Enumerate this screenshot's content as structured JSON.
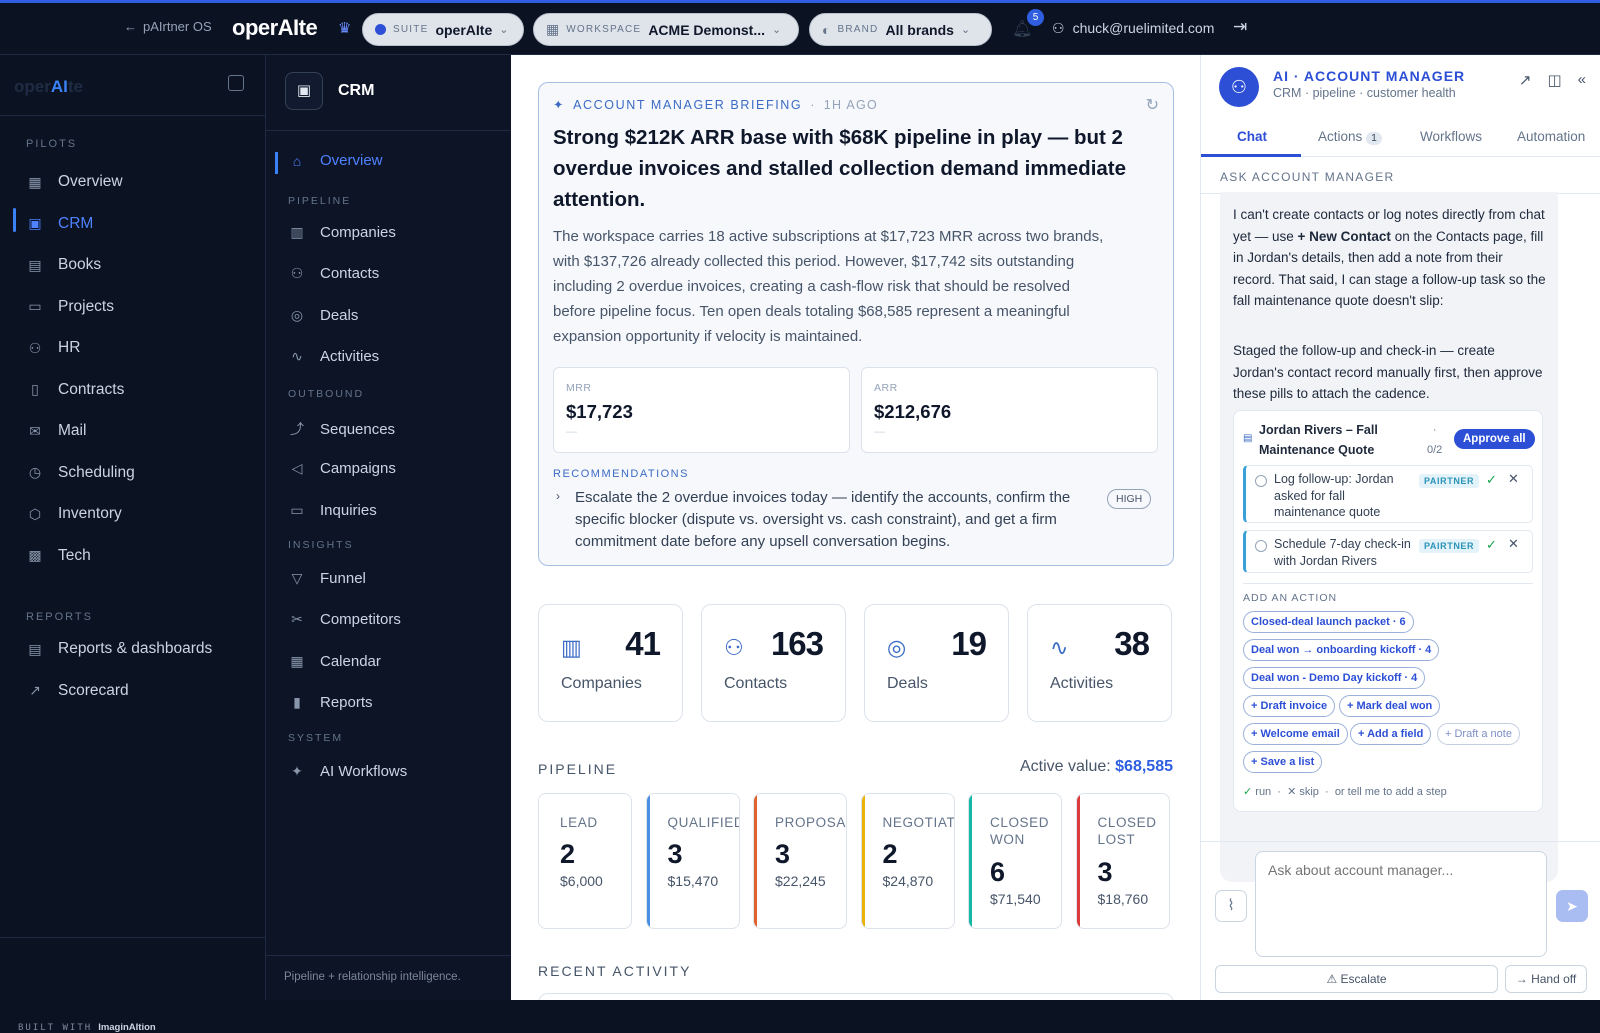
{
  "topbar": {
    "back_label": "pAIrtner OS",
    "logo": "operAIte",
    "suite": {
      "key": "SUITE",
      "value": "operAIte"
    },
    "workspace": {
      "key": "WORKSPACE",
      "value": "ACME Demonst..."
    },
    "brand": {
      "key": "BRAND",
      "value": "All brands"
    },
    "notifications_count": "5",
    "user_email": "chuck@ruelimited.com",
    "accent_color": "#2f5fe0"
  },
  "sidebar": {
    "brand_left": "oper",
    "brand_ai": "AI",
    "brand_right": "te",
    "pilots_header": "PILOTS",
    "pilots": [
      {
        "label": "Overview",
        "icon": "grid-icon"
      },
      {
        "label": "CRM",
        "icon": "briefcase-icon",
        "active": true
      },
      {
        "label": "Books",
        "icon": "calculator-icon"
      },
      {
        "label": "Projects",
        "icon": "folder-icon"
      },
      {
        "label": "HR",
        "icon": "people-icon"
      },
      {
        "label": "Contracts",
        "icon": "document-icon"
      },
      {
        "label": "Mail",
        "icon": "mail-icon"
      },
      {
        "label": "Scheduling",
        "icon": "calendar-clock-icon"
      },
      {
        "label": "Inventory",
        "icon": "box-icon"
      },
      {
        "label": "Tech",
        "icon": "chip-icon"
      }
    ],
    "reports_header": "REPORTS",
    "reports": [
      {
        "label": "Reports & dashboards",
        "icon": "report-icon"
      },
      {
        "label": "Scorecard",
        "icon": "trend-icon"
      }
    ],
    "built_with": "BUILT WITH",
    "built_with_brand": "ImaginAItion"
  },
  "crm_nav": {
    "title": "CRM",
    "overview": "Overview",
    "pipeline_header": "PIPELINE",
    "pipeline": [
      "Companies",
      "Contacts",
      "Deals",
      "Activities"
    ],
    "outbound_header": "OUTBOUND",
    "outbound": [
      "Sequences",
      "Campaigns",
      "Inquiries"
    ],
    "insights_header": "INSIGHTS",
    "insights": [
      "Funnel",
      "Competitors",
      "Calendar",
      "Reports"
    ],
    "system_header": "SYSTEM",
    "system": [
      "AI Workflows"
    ],
    "footer": "Pipeline + relationship intelligence."
  },
  "briefing": {
    "label": "ACCOUNT MANAGER BRIEFING",
    "age": "1H AGO",
    "headline": "Strong $212K ARR base with $68K pipeline in play — but 2 overdue invoices and stalled collection demand immediate attention.",
    "body": "The workspace carries 18 active subscriptions at $17,723 MRR across two brands, with $137,726 already collected this period. However, $17,742 sits outstanding including 2 overdue invoices, creating a cash-flow risk that should be resolved before pipeline focus. Ten open deals totaling $68,585 represent a meaningful expansion opportunity if velocity is maintained.",
    "metrics": [
      {
        "label": "MRR",
        "value": "$17,723",
        "delta": "—"
      },
      {
        "label": "ARR",
        "value": "$212,676",
        "delta": "—"
      }
    ],
    "recommendations_label": "RECOMMENDATIONS",
    "recommendation": "Escalate the 2 overdue invoices today — identify the accounts, confirm the specific blocker (dispute vs. oversight vs. cash constraint), and get a firm commitment date before any upsell conversation begins.",
    "priority": "HIGH"
  },
  "stats": [
    {
      "value": "41",
      "label": "Companies"
    },
    {
      "value": "163",
      "label": "Contacts"
    },
    {
      "value": "19",
      "label": "Deals"
    },
    {
      "value": "38",
      "label": "Activities"
    }
  ],
  "pipeline": {
    "header": "PIPELINE",
    "active_label": "Active value:",
    "active_value": "$68,585",
    "stages": [
      {
        "name": "LEAD",
        "count": "2",
        "amount": "$6,000",
        "color": "#ffffff"
      },
      {
        "name": "QUALIFIED",
        "count": "3",
        "amount": "$15,470",
        "color": "#4a90e2"
      },
      {
        "name": "PROPOSAL",
        "count": "3",
        "amount": "$22,245",
        "color": "#e0622c"
      },
      {
        "name": "NEGOTIATION",
        "count": "2",
        "amount": "$24,870",
        "color": "#eab308"
      },
      {
        "name": "CLOSED WON",
        "count": "6",
        "amount": "$71,540",
        "color": "#14b8a6"
      },
      {
        "name": "CLOSED LOST",
        "count": "3",
        "amount": "$18,760",
        "color": "#dc3b3b"
      }
    ]
  },
  "recent_header": "RECENT ACTIVITY",
  "assistant": {
    "title": "AI · ACCOUNT MANAGER",
    "subtitle": "CRM · pipeline · customer health",
    "tabs": [
      {
        "label": "Chat"
      },
      {
        "label": "Actions",
        "count": "1"
      },
      {
        "label": "Workflows"
      },
      {
        "label": "Automation"
      }
    ],
    "ask_label": "ASK ACCOUNT MANAGER",
    "msg1_a": "I can't create contacts or log notes directly from chat yet — use ",
    "msg1_b": "+ New Contact",
    "msg1_c": " on the Contacts page, fill in Jordan's details, then add a note from their record. That said, I can stage a follow-up task so the fall maintenance quote doesn't slip:",
    "msg2": "Staged the follow-up and check-in — create Jordan's contact record manually first, then approve these pills to attach the cadence.",
    "card_title": "Jordan Rivers – Fall Maintenance Quote",
    "card_dot": "·",
    "card_count": "0/2",
    "approve_all": "Approve all",
    "tasks": [
      {
        "text": "Log follow-up: Jordan asked for fall maintenance quote",
        "tag": "PAIRTNER"
      },
      {
        "text": "Schedule 7-day check-in with Jordan Rivers",
        "tag": "PAIRTNER"
      }
    ],
    "add_action": "ADD AN ACTION",
    "chips": [
      "Closed-deal launch packet · 6",
      "Deal won → onboarding kickoff · 4",
      "Deal won - Demo Day kickoff · 4",
      "+ Draft invoice",
      "+ Mark deal won",
      "+ Welcome email",
      "+ Add a field",
      "+ Draft a note",
      "+ Save a list"
    ],
    "footer_run": "run",
    "footer_skip": "skip",
    "footer_tell": "or tell me to add a step",
    "input_placeholder": "Ask about account manager...",
    "escalate": "Escalate",
    "hand_off": "Hand off"
  }
}
